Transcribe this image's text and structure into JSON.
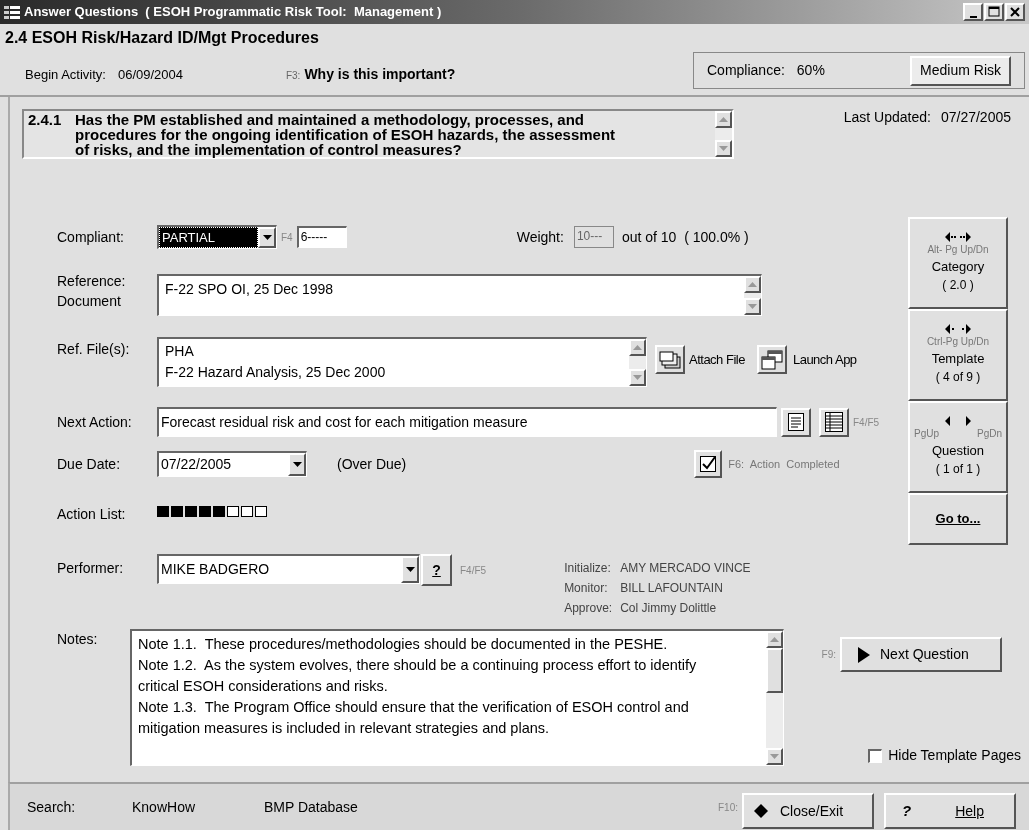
{
  "window": {
    "title": "Answer Questions  ( ESOH Programmatic Risk Tool:  Management )"
  },
  "header": {
    "title": "2.4 ESOH Risk/Hazard ID/Mgt Procedures",
    "begin_label": "Begin Activity:",
    "begin_date": "06/09/2004",
    "why_key": "F3:",
    "why_text": "Why is this important?",
    "compliance_label": "Compliance:",
    "compliance_value": "60%",
    "risk_button": "Medium Risk"
  },
  "question": {
    "number": "2.4.1",
    "text": "Has the PM established and maintained a methodology, processes, and procedures for the ongoing identification of ESOH hazards, the assessment of risks, and the implementation of control measures?",
    "last_updated_label": "Last Updated:",
    "last_updated": "07/27/2005"
  },
  "compliant": {
    "label": "Compliant:",
    "value": "PARTIAL",
    "key": "F4",
    "score": "6-----",
    "weight_label": "Weight:",
    "weight": "10---",
    "out_of": "out of 10  ( 100.0% )"
  },
  "reference": {
    "label": "Reference:",
    "label2": "Document",
    "value": "F-22 SPO OI, 25 Dec 1998"
  },
  "ref_files": {
    "label": "Ref. File(s):",
    "lines": [
      "PHA",
      "F-22 Hazard Analysis, 25 Dec 2000"
    ],
    "attach": "Attach File",
    "launch": "Launch App"
  },
  "next_action": {
    "label": "Next Action:",
    "value": "Forecast residual risk and cost for each mitigation measure",
    "key": "F4/F5"
  },
  "due_date": {
    "label": "Due Date:",
    "value": "07/22/2005",
    "status": "(Over Due)",
    "completed_label": "F6:  Action  Completed",
    "completed": true
  },
  "action_list": {
    "label": "Action List:",
    "steps": [
      {
        "done": true
      },
      {
        "done": true
      },
      {
        "done": true
      },
      {
        "done": true
      },
      {
        "done": true
      },
      {
        "done": false
      },
      {
        "done": false
      },
      {
        "done": false
      }
    ]
  },
  "performer": {
    "label": "Performer:",
    "value": "MIKE BADGERO",
    "help": "?",
    "key": "F4/F5",
    "roles": [
      {
        "role": "Initialize:",
        "name": "AMY MERCADO VINCE"
      },
      {
        "role": "Monitor:",
        "name": "BILL LAFOUNTAIN"
      },
      {
        "role": "Approve:",
        "name": "Col Jimmy Dolittle"
      }
    ]
  },
  "navigation": [
    {
      "kind": "category",
      "hints": [
        "Alt- Pg Up/Dn"
      ],
      "label": "Category",
      "count": "( 2.0 )"
    },
    {
      "kind": "template",
      "hints": [
        "Ctrl-Pg Up/Dn"
      ],
      "label": "Template",
      "count": "( 4 of 9 )"
    },
    {
      "kind": "question",
      "hints": [
        "PgUp",
        "PgDn"
      ],
      "label": "Question",
      "count": "( 1 of 1 )"
    }
  ],
  "goto_button": "Go to...",
  "notes": {
    "label": "Notes:",
    "lines": [
      "Note 1.1.  These procedures/methodologies should be documented in the PESHE.",
      "Note 1.2.  As the system evolves, there should be a continuing process effort to identify critical ESOH considerations and risks.",
      "Note 1.3.  The Program Office should ensure that the verification of ESOH control and mitigation measures is included in relevant strategies and plans."
    ]
  },
  "next_question": {
    "key": "F9:",
    "label": "Next Question"
  },
  "hide_template": {
    "label": "Hide Template Pages",
    "checked": false
  },
  "bottom_bar": {
    "search_label": "Search:",
    "links": [
      "KnowHow",
      "BMP Database"
    ],
    "close_key": "F10:",
    "close": "Close/Exit",
    "help_icon": "?",
    "help": "Help"
  }
}
